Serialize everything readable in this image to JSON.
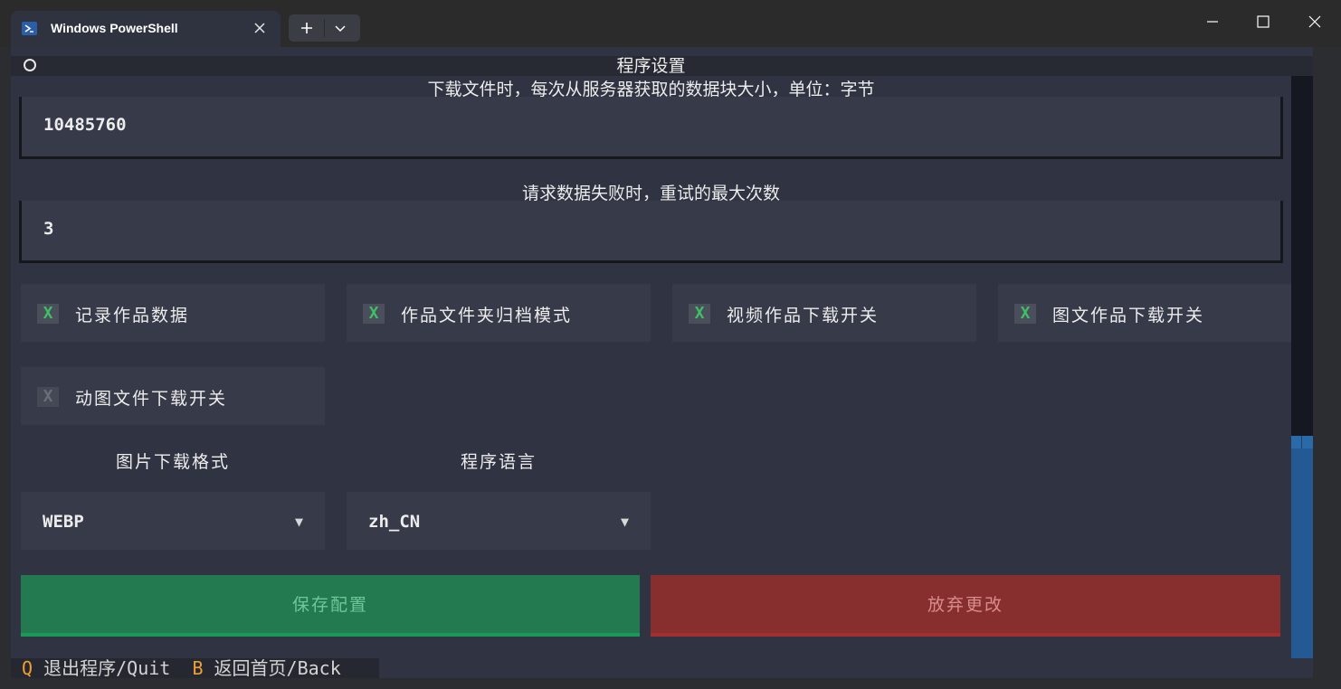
{
  "window": {
    "tab_title": "Windows PowerShell"
  },
  "app": {
    "title": "程序设置",
    "chunk_label": "下载文件时，每次从服务器获取的数据块大小，单位：字节",
    "chunk_value": "10485760",
    "retry_label": "请求数据失败时，重试的最大次数",
    "retry_value": "3",
    "checkboxes": [
      {
        "mark": "X",
        "label": "记录作品数据",
        "checked": true
      },
      {
        "mark": "X",
        "label": "作品文件夹归档模式",
        "checked": true
      },
      {
        "mark": "X",
        "label": "视频作品下载开关",
        "checked": true
      },
      {
        "mark": "X",
        "label": "图文作品下载开关",
        "checked": true
      },
      {
        "mark": "X",
        "label": "动图文件下载开关",
        "checked": false
      }
    ],
    "image_format_label": "图片下载格式",
    "image_format_value": "WEBP",
    "language_label": "程序语言",
    "language_value": "zh_CN",
    "dropdown_arrow": "▼",
    "save_button": "保存配置",
    "discard_button": "放弃更改"
  },
  "footer": {
    "quit_key": "Q",
    "quit_label": "退出程序/Quit",
    "back_key": "B",
    "back_label": "返回首页/Back"
  },
  "colors": {
    "accent_check": "#3fbf66",
    "save": "#247a50",
    "discard": "#872f2f",
    "key": "#f0a030",
    "scrollbar": "#245a93"
  }
}
